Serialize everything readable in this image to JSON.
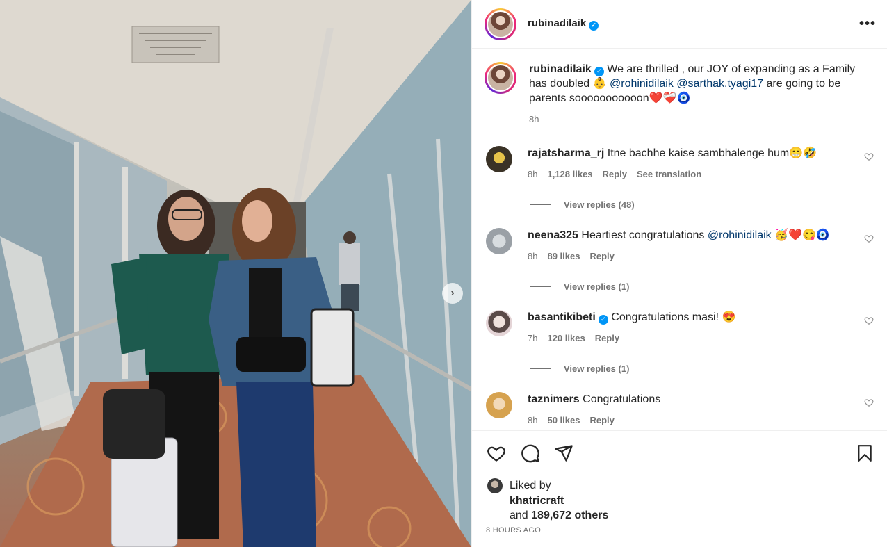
{
  "post": {
    "username": "rubinadilaik",
    "verified_badge": "✓",
    "more_label": "•••",
    "caption": {
      "username": "rubinadilaik",
      "text_1": "We are thrilled , our JOY of expanding as a Family has doubled 👶 ",
      "mention_1": "@rohinidilaik",
      "mention_2": "@sarthak.tyagi17",
      "text_2": " are going to be parents sooooooooooon❤️❤️‍🩹🧿",
      "time": "8h"
    }
  },
  "comments": [
    {
      "username": "rajatsharma_rj",
      "text": "Itne bachhe kaise sambhalenge hum😁🤣",
      "time": "8h",
      "likes": "1,128 likes",
      "reply": "Reply",
      "translation": "See translation",
      "view_replies": "View replies (48)",
      "avatar_color": "#3a3226"
    },
    {
      "username": "neena325",
      "text_pre": "Heartiest congratulations ",
      "mention": "@rohinidilaik",
      "text_post": " 🥳❤️😋🧿",
      "time": "8h",
      "likes": "89 likes",
      "reply": "Reply",
      "view_replies": "View replies (1)",
      "avatar_color": "#9aa0a6"
    },
    {
      "username": "basantikibeti",
      "text": "Congratulations masi! 😍",
      "time": "7h",
      "likes": "120 likes",
      "reply": "Reply",
      "view_replies": "View replies (1)",
      "avatar_color": "#d9c3c6"
    },
    {
      "username": "taznimers",
      "text": "Congratulations",
      "time": "8h",
      "likes": "50 likes",
      "reply": "Reply",
      "avatar_color": "#d6a24f"
    }
  ],
  "actions": {
    "liked_by_label": "Liked by",
    "liked_by_user": "khatricraft",
    "and_label": "and",
    "others": "189,672 others",
    "date": "8 HOURS AGO"
  },
  "icons": [
    "like-icon",
    "comment-icon",
    "share-icon",
    "save-icon",
    "next-arrow-icon",
    "more-options-icon",
    "verified-icon"
  ],
  "colors": {
    "accent": "#0095f6",
    "mention": "#00376b",
    "secondary_text": "#737373"
  }
}
